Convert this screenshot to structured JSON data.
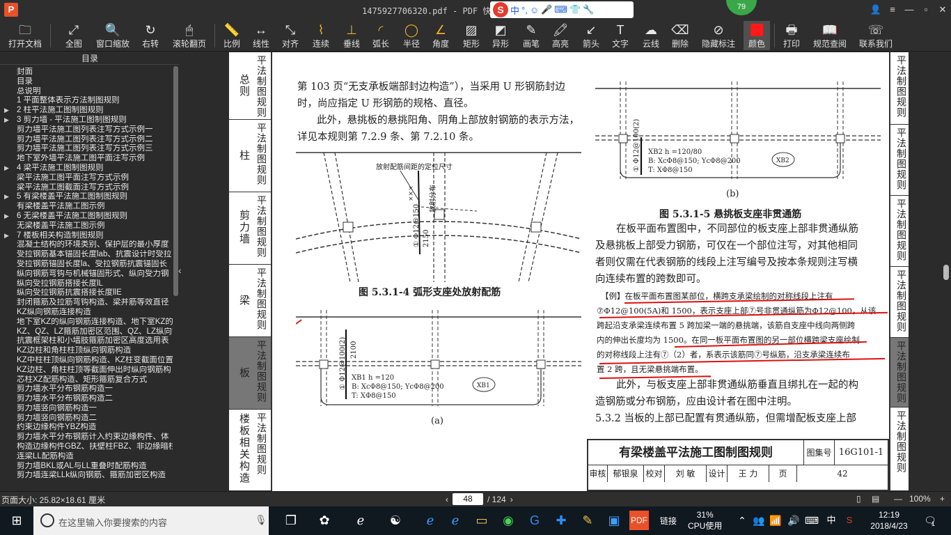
{
  "window": {
    "title": "1475927706320.pdf - PDF 快速看图",
    "badge": "79",
    "app_logo": "P"
  },
  "ime": {
    "logo": "S",
    "mode": "中",
    "punct": "°,"
  },
  "toolbar": {
    "open": "打开文档",
    "fit": "全图",
    "window_zoom": "窗口缩放",
    "rotate": "右转",
    "scroll": "滚轮翻页",
    "scale": "比例",
    "linear": "线性",
    "align": "对齐",
    "continuous": "连续",
    "perpendicular": "垂线",
    "arc": "弧长",
    "radius": "半径",
    "angle": "角度",
    "rect": "矩形",
    "shape": "异形",
    "pen": "画笔",
    "height": "高亮",
    "arrow": "箭头",
    "text": "文字",
    "cloud": "云线",
    "delete": "删除",
    "hide": "隐藏标注",
    "color": "颜色",
    "print": "打印",
    "norms": "规范查阅",
    "contact": "联系我们",
    "color_value": "#ff1a1a"
  },
  "sidebar": {
    "title": "目录",
    "items": [
      {
        "label": "封面",
        "exp": ""
      },
      {
        "label": "目录",
        "exp": ""
      },
      {
        "label": "总说明",
        "exp": ""
      },
      {
        "label": "1  平面整体表示方法制图规则",
        "exp": ""
      },
      {
        "label": "2  柱平法施工图制图规则",
        "exp": "▶"
      },
      {
        "label": "3  剪力墙 - 平法施工图制图规则",
        "exp": "▶"
      },
      {
        "label": "剪力墙平法施工图列表注写方式示例一",
        "exp": ""
      },
      {
        "label": "剪力墙平法施工图列表注写方式示例二",
        "exp": ""
      },
      {
        "label": "剪力墙平法施工图列表注写方式示例三",
        "exp": ""
      },
      {
        "label": "地下室外墙平法施工图平面注写示例",
        "exp": ""
      },
      {
        "label": "4  梁平法施工图制图规则",
        "exp": "▶"
      },
      {
        "label": "梁平法施工图平面注写方式示例",
        "exp": ""
      },
      {
        "label": "梁平法施工图截面注写方式示例",
        "exp": ""
      },
      {
        "label": "5  有梁楼盖平法施工图制图规则",
        "exp": "▶"
      },
      {
        "label": "有梁楼盖平法施工图示例",
        "exp": ""
      },
      {
        "label": "6  无梁楼盖平法施工图制图规则",
        "exp": "▶"
      },
      {
        "label": "无梁楼盖平法施工图示例",
        "exp": ""
      },
      {
        "label": "7  楼板相关构造制图规则",
        "exp": "▶"
      },
      {
        "label": "混凝土结构的环境类别、保护层的最小厚度",
        "exp": ""
      },
      {
        "label": "受拉钢筋基本锚固长度lab、抗震设计时受拉",
        "exp": ""
      },
      {
        "label": "受拉钢筋锚固长度la、受拉钢筋抗震锚固长",
        "exp": ""
      },
      {
        "label": "纵向钢筋弯钩与机械锚固形式、纵向受力钢",
        "exp": ""
      },
      {
        "label": "纵向受拉钢筋搭接长度lL",
        "exp": ""
      },
      {
        "label": "纵向受拉钢筋抗震搭接长度llE",
        "exp": ""
      },
      {
        "label": "封闭箍筋及拉筋弯钩构造、梁并筋等效直径",
        "exp": ""
      },
      {
        "label": "KZ纵向钢筋连接构造",
        "exp": ""
      },
      {
        "label": "地下室KZ的纵向钢筋连接构造、地下室KZ的",
        "exp": ""
      },
      {
        "label": "KZ、QZ、LZ箍筋加密区范围、QZ、LZ纵向钢",
        "exp": ""
      },
      {
        "label": "抗震框架柱和小墙肢箍筋加密区高度选用表",
        "exp": ""
      },
      {
        "label": "KZ边柱和角柱柱顶纵向钢筋构造",
        "exp": ""
      },
      {
        "label": "KZ中柱柱顶纵向钢筋构造、KZ柱变截面位置",
        "exp": ""
      },
      {
        "label": "KZ边柱、角柱柱顶等截面伸出时纵向钢筋构",
        "exp": ""
      },
      {
        "label": "芯柱XZ配筋构造、矩形箍筋复合方式",
        "exp": ""
      },
      {
        "label": "剪力墙水平分布钢筋构造一",
        "exp": ""
      },
      {
        "label": "剪力墙水平分布钢筋构造二",
        "exp": ""
      },
      {
        "label": "剪力墙竖向钢筋构造一",
        "exp": ""
      },
      {
        "label": "剪力墙竖向钢筋构造二",
        "exp": ""
      },
      {
        "label": "约束边缘构件YBZ构造",
        "exp": ""
      },
      {
        "label": "剪力墙水平分布钢筋计入约束边缘构件、体",
        "exp": ""
      },
      {
        "label": "构造边缘构件GBZ、扶壁柱FBZ、非边缘暗柱",
        "exp": ""
      },
      {
        "label": "连梁LL配筋构造",
        "exp": ""
      },
      {
        "label": "剪力墙BKL或AL与LL重叠时配筋构造",
        "exp": ""
      },
      {
        "label": "剪力墙连梁LLk纵向钢筋、箍筋加密区构造",
        "exp": ""
      }
    ]
  },
  "page": {
    "left_tabs": [
      {
        "main": "总则",
        "sub": "平法制图规则"
      },
      {
        "main": "柱",
        "sub": "平法制图规则"
      },
      {
        "main": "剪力墙",
        "sub": "平法制图规则"
      },
      {
        "main": "梁",
        "sub": "平法制图规则"
      },
      {
        "main": "板",
        "sub": "平法制图规则"
      },
      {
        "main": "楼板相关构造",
        "sub": "平法制图规则"
      }
    ],
    "right_tabs": [
      "平法制图规则",
      "平法制图规则",
      "平法制图规则",
      "平法制图规则",
      "平法制图规则",
      "平法制图规则"
    ],
    "para1": [
      "第 103 页“无支承板端部封边构造”），当采用 U 形钢筋封边",
      "时，尚应指定 U 形钢筋的规格、直径。",
      "此外，悬挑板的悬挑阳角、阴角上部放射钢筋的表示方法，",
      "详见本规则第 7.2.9 条、第 7.2.10 条。"
    ],
    "fig1_note": "放射配筋间距的定位尺寸",
    "fig1_side": "放射分布",
    "fig1_label": "① Φ12@150",
    "fig1_dim": "2150",
    "fig1_x": "×××",
    "fig1_caption": "图 5.3.1-4   弧形支座处放射配筋",
    "figa_label": "① Φ12@100(2)",
    "figa_dim": "2100",
    "figa_lines": [
      "XB1   h =120",
      "B: XcΦ8@150; YcΦ8@200",
      "T: XΦ8@150"
    ],
    "figa_tag": "XB1",
    "figa_caption": "(a)",
    "figb_label": "① Φ12@100(2)",
    "figb_lines": [
      "XB2   h =120/80",
      "B: XcΦ8@150; YcΦ8@200",
      "T: XΦ8@150"
    ],
    "figb_tag": "XB2",
    "figb_caption": "(b)",
    "fig2_caption": "图 5.3.1-5   悬挑板支座非贯通筋",
    "para2": [
      "在板平面布置图中，不同部位的板支座上部非贯通纵筋",
      "及悬挑板上部受力钢筋，可仅在一个部位注写，对其他相同",
      "者则仅需在代表钢筋的线段上注写编号及按本条规则注写横",
      "向连续布置的跨数即可。"
    ],
    "example": [
      "【例】在板平面布置图某部位，横跨支承梁绘制的对称线段上注有",
      "⑦Φ12@100(5A)和 1500，表示支座上部⑦号非贯通纵筋为Φ12@100，从该",
      "跨起沿支承梁连续布置 5 跨加梁一端的悬挑端，该筋自支座中线向两侧跨",
      "内的伸出长度均为 1500。在同一板平面布置图的另一部位横跨梁支座绘制",
      "的对称线段上注有⑦（2）者，系表示该筋同⑦号纵筋，沿支承梁连续布",
      "置 2 跨，且无梁悬挑端布置。"
    ],
    "para3": [
      "此外，与板支座上部非贯通纵筋垂直且绑扎在一起的构",
      "造钢筋或分布钢筋，应由设计者在图中注明。",
      "5.3.2  当板的上部已配置有贯通纵筋，但需增配板支座上部"
    ],
    "title_block": {
      "title": "有梁楼盖平法施工图制图规则",
      "atlas_label": "图集号",
      "atlas_no": "16G101-1",
      "row2": [
        "审核",
        "郁银泉",
        "校对",
        "刘 敏",
        "设计",
        "王 力",
        "页",
        "42"
      ]
    }
  },
  "status": {
    "page_size": "页面大小: 25.82×18.61 厘米",
    "current_page": "48",
    "total_pages": "/ 124",
    "zoom": "100%"
  },
  "taskbar": {
    "search_placeholder": "在这里输入你要搜索的内容",
    "link_label": "链接",
    "cpu_pct": "31%",
    "cpu_label": "CPU使用",
    "time": "12:19",
    "date": "2018/4/23",
    "ime_lang": "中",
    "notif_count": "1"
  }
}
